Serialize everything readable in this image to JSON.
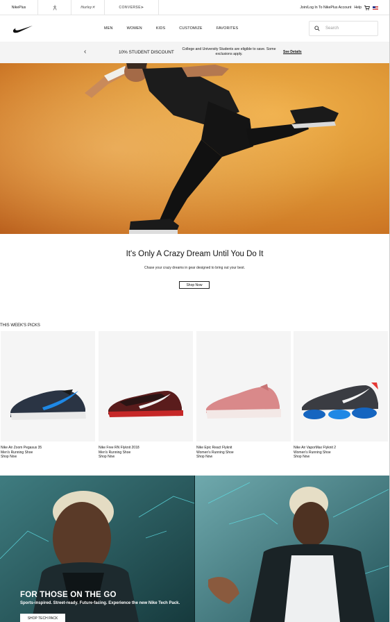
{
  "utility_bar": {
    "brands": [
      "NikePlus",
      "Hurley",
      "CONVERSE"
    ],
    "account_links": "Join/Log In To NikePlus Account",
    "help": "Help"
  },
  "nav": {
    "items": [
      "MEN",
      "WOMEN",
      "KIDS",
      "CUSTOMIZE",
      "FAVORITES"
    ],
    "search_placeholder": "Search"
  },
  "promo": {
    "headline": "10% STUDENT DISCOUNT",
    "detail": "College and University Students are eligible to save. Some exclusions apply.",
    "link": "See Details"
  },
  "hero": {
    "title": "It's Only A Crazy Dream Until You Do It",
    "subtitle": "Chase your crazy dreams in gear designed to bring out your best.",
    "cta": "Shop Now"
  },
  "picks": {
    "title": "THIS WEEK'S PICKS",
    "items": [
      {
        "name": "Nike Air Zoom Pegasus 35",
        "category": "Men's Running Shoe",
        "cta": "Shop Now"
      },
      {
        "name": "Nike Free RN Flyknit 2018",
        "category": "Men's Running Shoe",
        "cta": "Shop Now"
      },
      {
        "name": "Nike Epic React Flyknit",
        "category": "Women's Running Shoe",
        "cta": "Shop Now"
      },
      {
        "name": "Nike Air VaporMax Flyknit 2",
        "category": "Women's Running Shoe",
        "cta": "Shop Now"
      }
    ]
  },
  "techpack": {
    "title": "FOR THOSE ON THE GO",
    "subtitle": "Sports-inspired. Street-ready. Future-facing. Experience the new Nike Tech Pack.",
    "cta": "SHOP TECH PACK"
  },
  "colors": {
    "hero_orange": "#e09a38",
    "teal": "#2a5b60",
    "accent_cyan": "#5fe0e6"
  }
}
